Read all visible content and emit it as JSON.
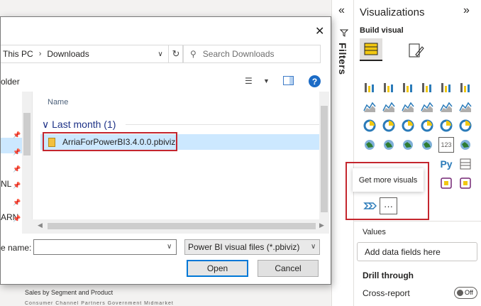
{
  "report": {
    "visual_title": "Sales by Segment and Product",
    "legend_text": "Consumer Channel Partners Government Midmarket Enterprise"
  },
  "filters_strip": {
    "collapse_glyph": "«",
    "label": "Filters"
  },
  "viz_pane": {
    "title": "Visualizations",
    "expand_glyph": "»",
    "build_visual_label": "Build visual",
    "tooltip": "Get more visuals",
    "more_button": "···",
    "values_label": "Values",
    "values_placeholder": "Add data fields here",
    "drill_through_title": "Drill through",
    "cross_report_label": "Cross-report",
    "cross_report_toggle": "Off",
    "python_visual_label": "Py",
    "card_visual_label": "123",
    "accent_color": "#f2c811"
  },
  "dialog": {
    "close_glyph": "✕",
    "breadcrumb": [
      "This PC",
      "Downloads"
    ],
    "refresh_glyph": "↻",
    "search_placeholder": "Search Downloads",
    "toolbar_text": "older",
    "column_name": "Name",
    "group_header": "Last month (1)",
    "nav_items": [
      "",
      "",
      "",
      "NL",
      "",
      "ARN",
      ""
    ],
    "file_name": "ArriaForPowerBI3.4.0.0.pbiviz",
    "file_name_label": "e name:",
    "file_name_value": "",
    "file_type": "Power BI visual files (*.pbiviz)",
    "open_label": "Open",
    "cancel_label": "Cancel",
    "help_glyph": "?",
    "highlight_color": "#c4262e",
    "selection_color": "#cce8ff"
  }
}
